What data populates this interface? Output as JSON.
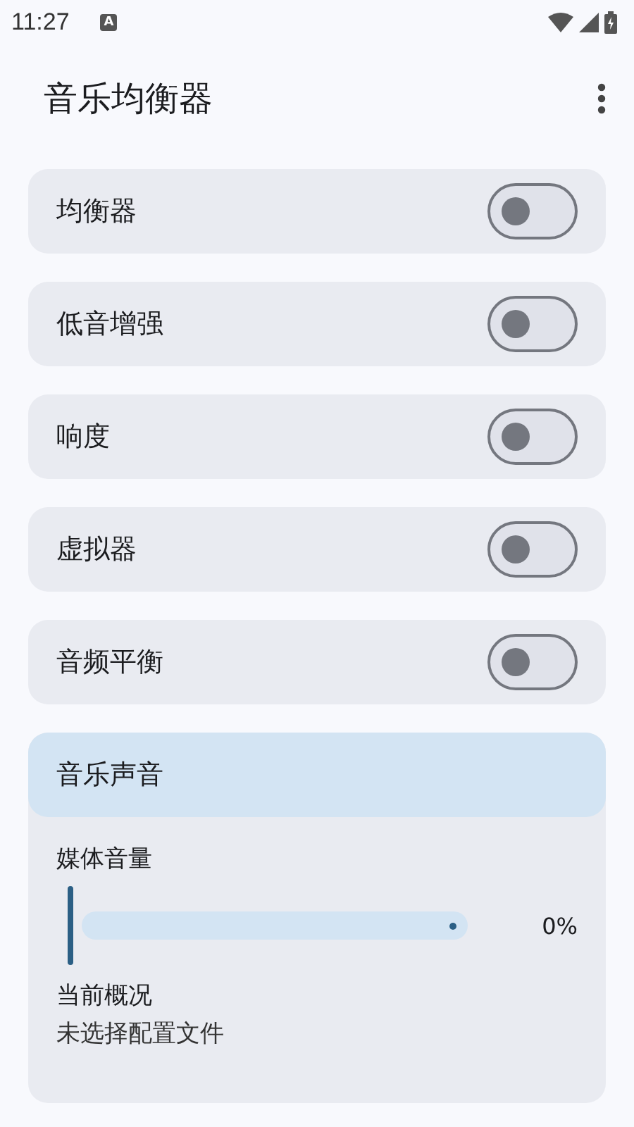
{
  "status_bar": {
    "time": "11:27",
    "notification": "A"
  },
  "app_bar": {
    "title": "音乐均衡器"
  },
  "toggles": [
    {
      "label": "均衡器",
      "on": false
    },
    {
      "label": "低音增强",
      "on": false
    },
    {
      "label": "响度",
      "on": false
    },
    {
      "label": "虚拟器",
      "on": false
    },
    {
      "label": "音频平衡",
      "on": false
    }
  ],
  "music_sound": {
    "title": "音乐声音",
    "volume_label": "媒体音量",
    "volume": {
      "level": 0,
      "reading": "0%"
    },
    "profile_label": "当前概况",
    "profile_value": "未选择配置文件"
  }
}
